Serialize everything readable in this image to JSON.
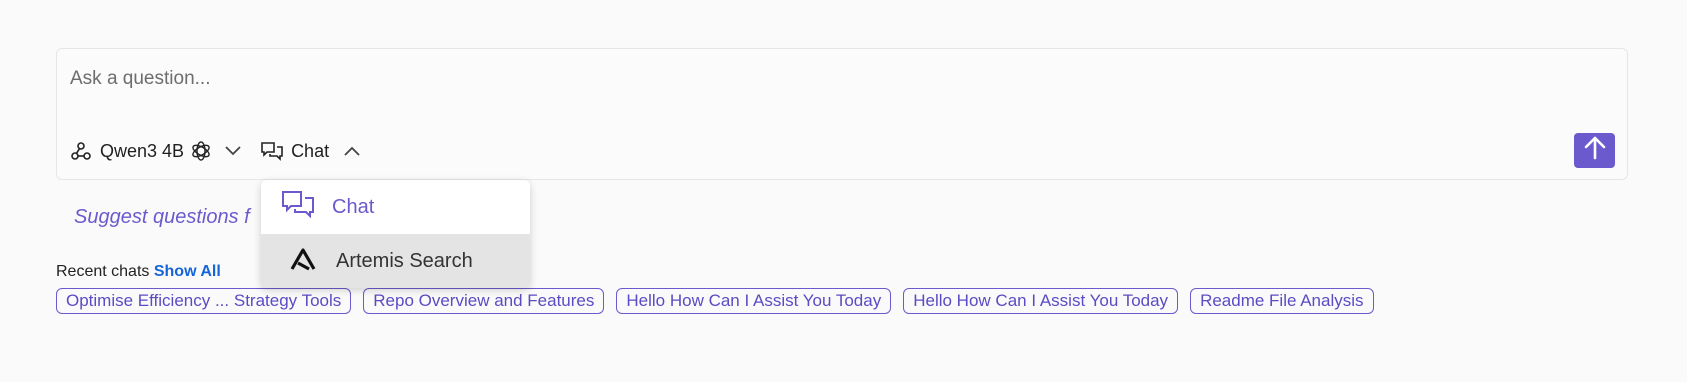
{
  "composer": {
    "placeholder": "Ask a question...",
    "model_label": "Qwen3 4B",
    "mode_label": "Chat"
  },
  "suggest_text": "Suggest questions f",
  "recent": {
    "label": "Recent chats",
    "show_all": "Show All",
    "chips": [
      "Optimise Efficiency ... Strategy Tools",
      "Repo Overview and Features",
      "Hello How Can I Assist You Today",
      "Hello How Can I Assist You Today",
      "Readme File Analysis"
    ]
  },
  "mode_menu": {
    "items": [
      {
        "label": "Chat",
        "icon": "chat-bubbles-icon",
        "selected": true
      },
      {
        "label": "Artemis Search",
        "icon": "artemis-logo-icon",
        "selected": false
      }
    ]
  },
  "colors": {
    "accent": "#6a5acd",
    "link": "#1565d8",
    "background": "#fafafa"
  }
}
